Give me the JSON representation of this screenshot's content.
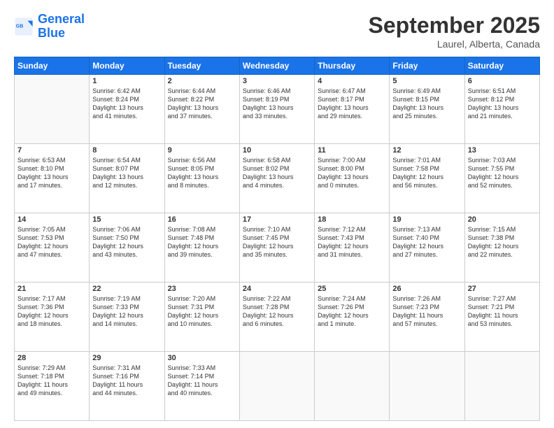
{
  "header": {
    "logo_general": "General",
    "logo_blue": "Blue",
    "month": "September 2025",
    "location": "Laurel, Alberta, Canada"
  },
  "weekdays": [
    "Sunday",
    "Monday",
    "Tuesday",
    "Wednesday",
    "Thursday",
    "Friday",
    "Saturday"
  ],
  "weeks": [
    [
      {
        "day": "",
        "info": ""
      },
      {
        "day": "1",
        "info": "Sunrise: 6:42 AM\nSunset: 8:24 PM\nDaylight: 13 hours\nand 41 minutes."
      },
      {
        "day": "2",
        "info": "Sunrise: 6:44 AM\nSunset: 8:22 PM\nDaylight: 13 hours\nand 37 minutes."
      },
      {
        "day": "3",
        "info": "Sunrise: 6:46 AM\nSunset: 8:19 PM\nDaylight: 13 hours\nand 33 minutes."
      },
      {
        "day": "4",
        "info": "Sunrise: 6:47 AM\nSunset: 8:17 PM\nDaylight: 13 hours\nand 29 minutes."
      },
      {
        "day": "5",
        "info": "Sunrise: 6:49 AM\nSunset: 8:15 PM\nDaylight: 13 hours\nand 25 minutes."
      },
      {
        "day": "6",
        "info": "Sunrise: 6:51 AM\nSunset: 8:12 PM\nDaylight: 13 hours\nand 21 minutes."
      }
    ],
    [
      {
        "day": "7",
        "info": "Sunrise: 6:53 AM\nSunset: 8:10 PM\nDaylight: 13 hours\nand 17 minutes."
      },
      {
        "day": "8",
        "info": "Sunrise: 6:54 AM\nSunset: 8:07 PM\nDaylight: 13 hours\nand 12 minutes."
      },
      {
        "day": "9",
        "info": "Sunrise: 6:56 AM\nSunset: 8:05 PM\nDaylight: 13 hours\nand 8 minutes."
      },
      {
        "day": "10",
        "info": "Sunrise: 6:58 AM\nSunset: 8:02 PM\nDaylight: 13 hours\nand 4 minutes."
      },
      {
        "day": "11",
        "info": "Sunrise: 7:00 AM\nSunset: 8:00 PM\nDaylight: 13 hours\nand 0 minutes."
      },
      {
        "day": "12",
        "info": "Sunrise: 7:01 AM\nSunset: 7:58 PM\nDaylight: 12 hours\nand 56 minutes."
      },
      {
        "day": "13",
        "info": "Sunrise: 7:03 AM\nSunset: 7:55 PM\nDaylight: 12 hours\nand 52 minutes."
      }
    ],
    [
      {
        "day": "14",
        "info": "Sunrise: 7:05 AM\nSunset: 7:53 PM\nDaylight: 12 hours\nand 47 minutes."
      },
      {
        "day": "15",
        "info": "Sunrise: 7:06 AM\nSunset: 7:50 PM\nDaylight: 12 hours\nand 43 minutes."
      },
      {
        "day": "16",
        "info": "Sunrise: 7:08 AM\nSunset: 7:48 PM\nDaylight: 12 hours\nand 39 minutes."
      },
      {
        "day": "17",
        "info": "Sunrise: 7:10 AM\nSunset: 7:45 PM\nDaylight: 12 hours\nand 35 minutes."
      },
      {
        "day": "18",
        "info": "Sunrise: 7:12 AM\nSunset: 7:43 PM\nDaylight: 12 hours\nand 31 minutes."
      },
      {
        "day": "19",
        "info": "Sunrise: 7:13 AM\nSunset: 7:40 PM\nDaylight: 12 hours\nand 27 minutes."
      },
      {
        "day": "20",
        "info": "Sunrise: 7:15 AM\nSunset: 7:38 PM\nDaylight: 12 hours\nand 22 minutes."
      }
    ],
    [
      {
        "day": "21",
        "info": "Sunrise: 7:17 AM\nSunset: 7:36 PM\nDaylight: 12 hours\nand 18 minutes."
      },
      {
        "day": "22",
        "info": "Sunrise: 7:19 AM\nSunset: 7:33 PM\nDaylight: 12 hours\nand 14 minutes."
      },
      {
        "day": "23",
        "info": "Sunrise: 7:20 AM\nSunset: 7:31 PM\nDaylight: 12 hours\nand 10 minutes."
      },
      {
        "day": "24",
        "info": "Sunrise: 7:22 AM\nSunset: 7:28 PM\nDaylight: 12 hours\nand 6 minutes."
      },
      {
        "day": "25",
        "info": "Sunrise: 7:24 AM\nSunset: 7:26 PM\nDaylight: 12 hours\nand 1 minute."
      },
      {
        "day": "26",
        "info": "Sunrise: 7:26 AM\nSunset: 7:23 PM\nDaylight: 11 hours\nand 57 minutes."
      },
      {
        "day": "27",
        "info": "Sunrise: 7:27 AM\nSunset: 7:21 PM\nDaylight: 11 hours\nand 53 minutes."
      }
    ],
    [
      {
        "day": "28",
        "info": "Sunrise: 7:29 AM\nSunset: 7:18 PM\nDaylight: 11 hours\nand 49 minutes."
      },
      {
        "day": "29",
        "info": "Sunrise: 7:31 AM\nSunset: 7:16 PM\nDaylight: 11 hours\nand 44 minutes."
      },
      {
        "day": "30",
        "info": "Sunrise: 7:33 AM\nSunset: 7:14 PM\nDaylight: 11 hours\nand 40 minutes."
      },
      {
        "day": "",
        "info": ""
      },
      {
        "day": "",
        "info": ""
      },
      {
        "day": "",
        "info": ""
      },
      {
        "day": "",
        "info": ""
      }
    ]
  ]
}
